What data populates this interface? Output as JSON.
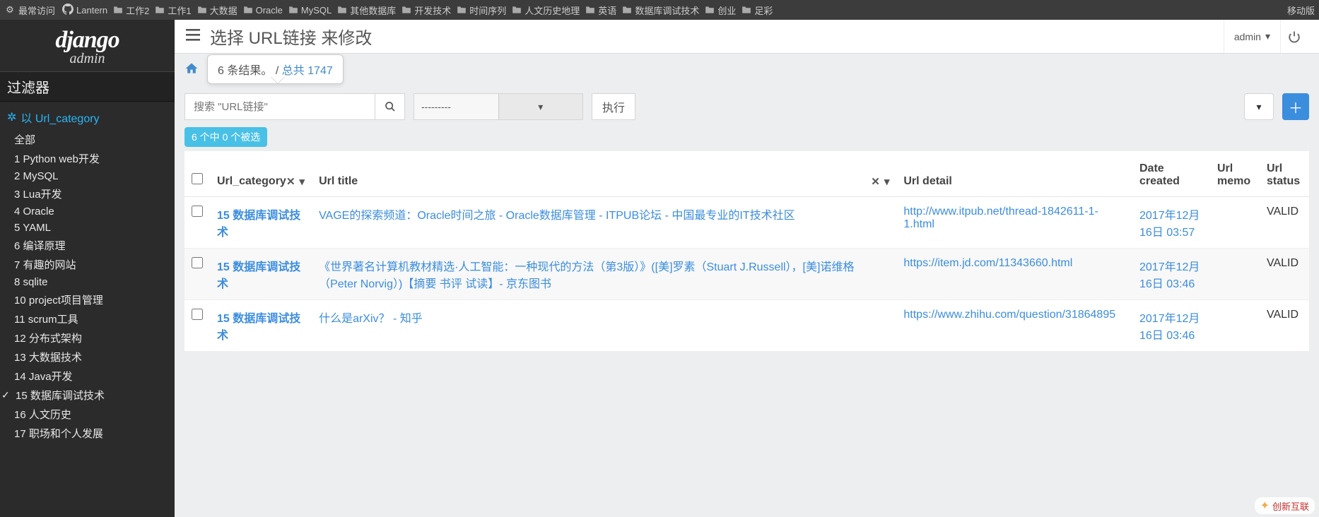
{
  "browser": {
    "frequent": "最常访问",
    "lantern": "Lantern",
    "folders": [
      "工作2",
      "工作1",
      "大数据",
      "Oracle",
      "MySQL",
      "其他数据库",
      "开发技术",
      "时间序列",
      "人文历史地理",
      "英语",
      "数据库调试技术",
      "创业",
      "足彩"
    ],
    "mobile": "移动版"
  },
  "brand": {
    "name": "django",
    "sub": "admin"
  },
  "sidebar": {
    "filter_header": "过滤器",
    "group_label": "以 Url_category",
    "items": [
      {
        "label": "全部",
        "selected": false
      },
      {
        "label": "1 Python web开发",
        "selected": false
      },
      {
        "label": "2 MySQL",
        "selected": false
      },
      {
        "label": "3 Lua开发",
        "selected": false
      },
      {
        "label": "4 Oracle",
        "selected": false
      },
      {
        "label": "5 YAML",
        "selected": false
      },
      {
        "label": "6 编译原理",
        "selected": false
      },
      {
        "label": "7 有趣的网站",
        "selected": false
      },
      {
        "label": "8 sqlite",
        "selected": false
      },
      {
        "label": "10 project项目管理",
        "selected": false
      },
      {
        "label": "11 scrum工具",
        "selected": false
      },
      {
        "label": "12 分布式架构",
        "selected": false
      },
      {
        "label": "13 大数据技术",
        "selected": false
      },
      {
        "label": "14 Java开发",
        "selected": false
      },
      {
        "label": "15 数据库调试技术",
        "selected": true
      },
      {
        "label": "16 人文历史",
        "selected": false
      },
      {
        "label": "17 职场和个人发展",
        "selected": false
      }
    ]
  },
  "header": {
    "title": "选择 URL链接 来修改",
    "admin_label": "admin"
  },
  "tooltip": {
    "results_text": "6 条结果。",
    "sep": " / ",
    "total_link": "总共 1747"
  },
  "search": {
    "placeholder": "搜索 \"URL链接\"",
    "action_placeholder": "---------",
    "exec_label": "执行"
  },
  "selection_badge": "6 个中 0 个被选",
  "table": {
    "headers": [
      "",
      "Url_category",
      "Url title",
      "Url detail",
      "Date created",
      "Url memo",
      "Url status"
    ],
    "rows": [
      {
        "category": "15 数据库调试技术",
        "title": "VAGE的探索频道：Oracle时间之旅 - Oracle数据库管理 - ITPUB论坛 - 中国最专业的IT技术社区",
        "detail": "http://www.itpub.net/thread-1842611-1-1.html",
        "date": "2017年12月16日 03:57",
        "memo": "",
        "status": "VALID"
      },
      {
        "category": "15 数据库调试技术",
        "title": "《世界著名计算机教材精选·人工智能：一种现代的方法（第3版）》([美]罗素（Stuart J.Russell），[美]诺维格（Peter Norvig）)【摘要 书评 试读】- 京东图书",
        "detail": "https://item.jd.com/11343660.html",
        "date": "2017年12月16日 03:46",
        "memo": "",
        "status": "VALID"
      },
      {
        "category": "15 数据库调试技术",
        "title": "什么是arXiv？ - 知乎",
        "detail": "https://www.zhihu.com/question/31864895",
        "date": "2017年12月16日 03:46",
        "memo": "",
        "status": "VALID"
      }
    ]
  },
  "watermark": "创新互联"
}
